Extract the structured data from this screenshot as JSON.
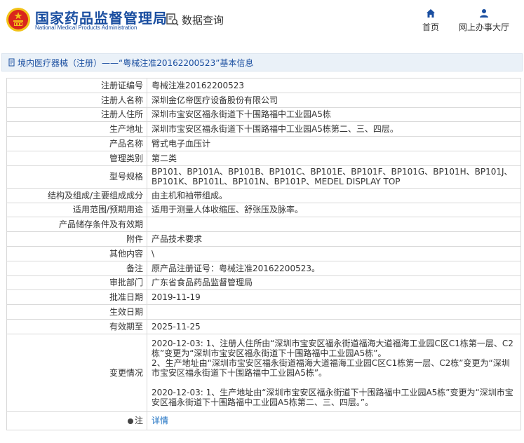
{
  "header": {
    "site_title": "国家药品监督管理局",
    "site_subtitle": "National Medical Products Administration",
    "query_label": "数据查询",
    "nav": {
      "home_label": "首页",
      "office_label": "网上办事大厅"
    }
  },
  "breadcrumb": {
    "text": "境内医疗器械（注册）——“粤械注准20162200523”基本信息"
  },
  "record": {
    "rows": [
      {
        "label": "注册证编号",
        "value": "粤械注准20162200523"
      },
      {
        "label": "注册人名称",
        "value": "深圳金亿帝医疗设备股份有限公司"
      },
      {
        "label": "注册人住所",
        "value": "深圳市宝安区福永街道下十围路福中工业园A5栋"
      },
      {
        "label": "生产地址",
        "value": "深圳市宝安区福永街道下十围路福中工业园A5栋第二、三、四层。"
      },
      {
        "label": "产品名称",
        "value": "臂式电子血压计"
      },
      {
        "label": "管理类别",
        "value": "第二类"
      },
      {
        "label": "型号规格",
        "value": "BP101、BP101A、BP101B、BP101C、BP101E、BP101F、BP101G、BP101H、BP101J、BP101K、BP101L、BP101N、BP101P、MEDEL DISPLAY TOP"
      },
      {
        "label": "结构及组成/主要组成成分",
        "value": "由主机和袖带组成。"
      },
      {
        "label": "适用范围/预期用途",
        "value": "适用于测量人体收缩压、舒张压及脉率。"
      },
      {
        "label": "产品储存条件及有效期",
        "value": ""
      },
      {
        "label": "附件",
        "value": "产品技术要求"
      },
      {
        "label": "其他内容",
        "value": "\\"
      },
      {
        "label": "备注",
        "value": "原产品注册证号：粤械注准20162200523。"
      },
      {
        "label": "审批部门",
        "value": "广东省食品药品监督管理局"
      },
      {
        "label": "批准日期",
        "value": "2019-11-19"
      },
      {
        "label": "生效日期",
        "value": ""
      },
      {
        "label": "有效期至",
        "value": "2025-11-25"
      }
    ],
    "changes": {
      "label": "变更情况",
      "line1": "2020-12-03: 1、注册人住所由“深圳市宝安区福永街道福海大道福海工业园C区C1栋第一层、C2栋”变更为“深圳市宝安区福永街道下十围路福中工业园A5栋”。",
      "line2": "2、生产地址由“深圳市宝安区福永街道福海大道福海工业园C区C1栋第一层、C2栋”变更为“深圳市宝安区福永街道下十围路福中工业园A5栋”。",
      "line3": "2020-12-03: 1、生产地址由“深圳市宝安区福永街道下十围路福中工业园A5栋”变更为“深圳市宝安区福永街道下十围路福中工业园A5栋第二、三、四层。”。"
    },
    "note": {
      "label": "注",
      "link": "详情"
    }
  },
  "colors": {
    "brand_blue": "#1a4ea0",
    "emblem_red": "#d9261c",
    "emblem_gold": "#f2c318",
    "link_blue": "#1a6fc2",
    "crumb_bg": "#eaf1f8"
  }
}
